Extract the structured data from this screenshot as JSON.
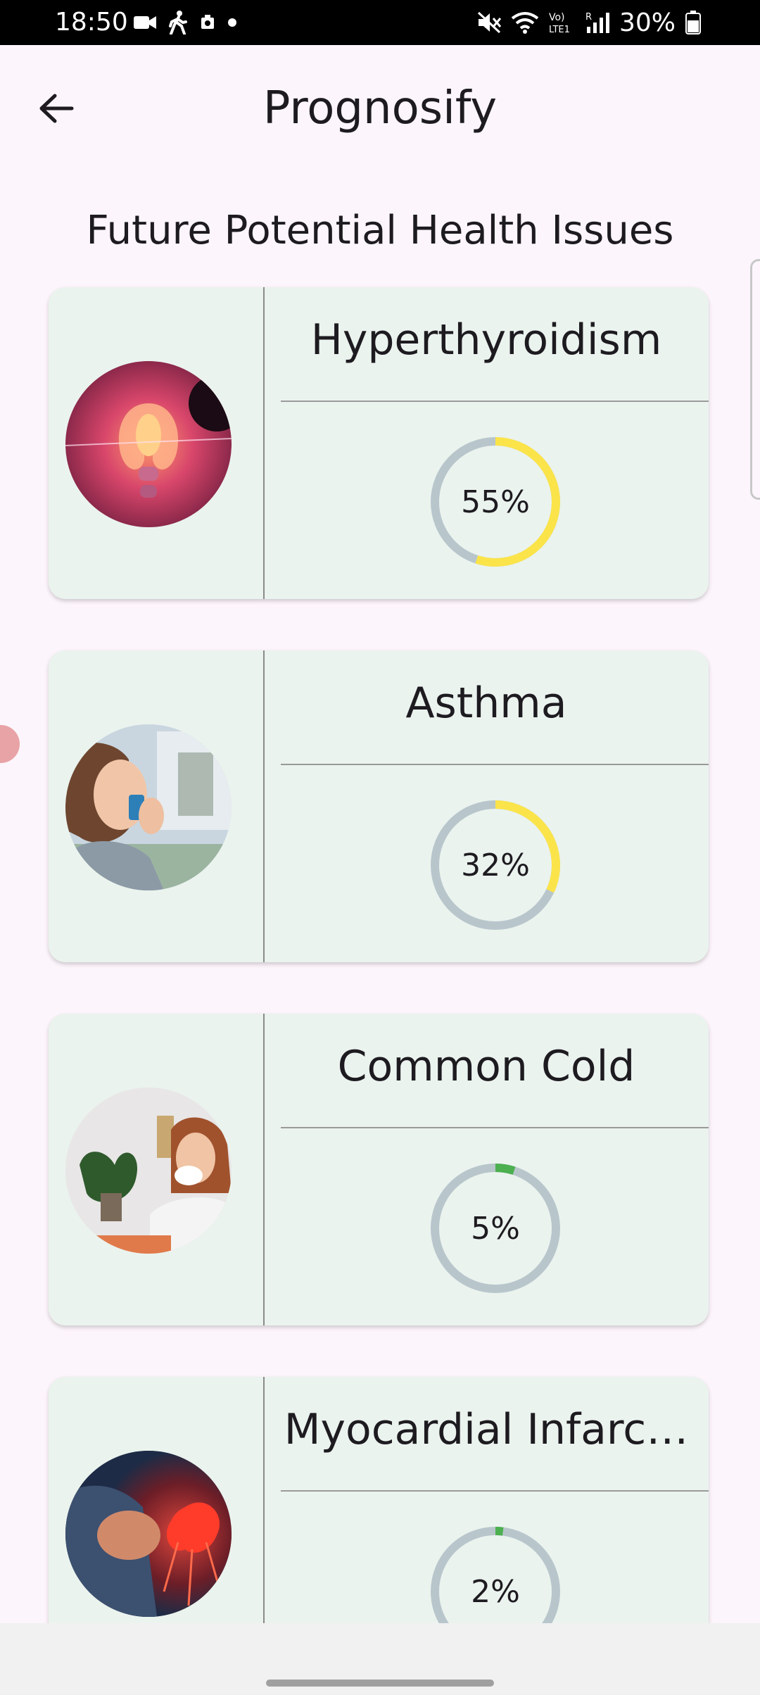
{
  "status_bar": {
    "time": "18:50",
    "battery_percent": "30%",
    "icons_left": [
      "video-camera-icon",
      "walking-icon",
      "photo-icon",
      "dot-icon"
    ],
    "icons_right": [
      "mute-icon",
      "wifi-icon",
      "volte-icon",
      "signal-icon",
      "battery-icon"
    ]
  },
  "app_bar": {
    "title": "Prognosify",
    "back_icon": "arrow-left-icon"
  },
  "section": {
    "title": "Future Potential Health Issues"
  },
  "conditions": [
    {
      "name": "Hyperthyroidism",
      "percent_label": "55%",
      "percent": 55,
      "color": "#fbe44a",
      "image": "thyroid-illustration"
    },
    {
      "name": "Asthma",
      "percent_label": "32%",
      "percent": 32,
      "color": "#fbe44a",
      "image": "inhaler-photo"
    },
    {
      "name": "Common Cold",
      "percent_label": "5%",
      "percent": 5,
      "color": "#4caf50",
      "image": "sneezing-photo"
    },
    {
      "name": "Myocardial Infarc…",
      "percent_label": "2%",
      "percent": 2,
      "color": "#4caf50",
      "image": "heart-attack-illustration"
    }
  ],
  "colors": {
    "background": "#fcf5fb",
    "card": "#ebf3ee",
    "ring_track": "#b8c6cc"
  }
}
